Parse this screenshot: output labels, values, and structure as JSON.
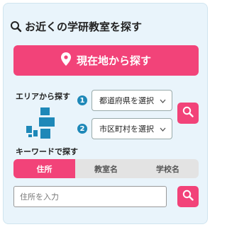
{
  "title": "お近くの学研教室を探す",
  "current_location_button": "現在地から探す",
  "area_search": {
    "label": "エリアから探す",
    "steps": [
      {
        "badge": "1",
        "select_value": "都道府県を選択"
      },
      {
        "badge": "2",
        "select_value": "市区町村を選択"
      }
    ]
  },
  "keyword_search": {
    "label": "キーワードで探す",
    "tabs": [
      {
        "label": "住所",
        "active": true
      },
      {
        "label": "教室名",
        "active": false
      },
      {
        "label": "学校名",
        "active": false
      }
    ],
    "input_placeholder": "住所を入力"
  },
  "colors": {
    "accent": "#f24379",
    "badge": "#1e88b8",
    "map_icon": "#1e88b8",
    "panel_bg": "#e9f4fb"
  }
}
